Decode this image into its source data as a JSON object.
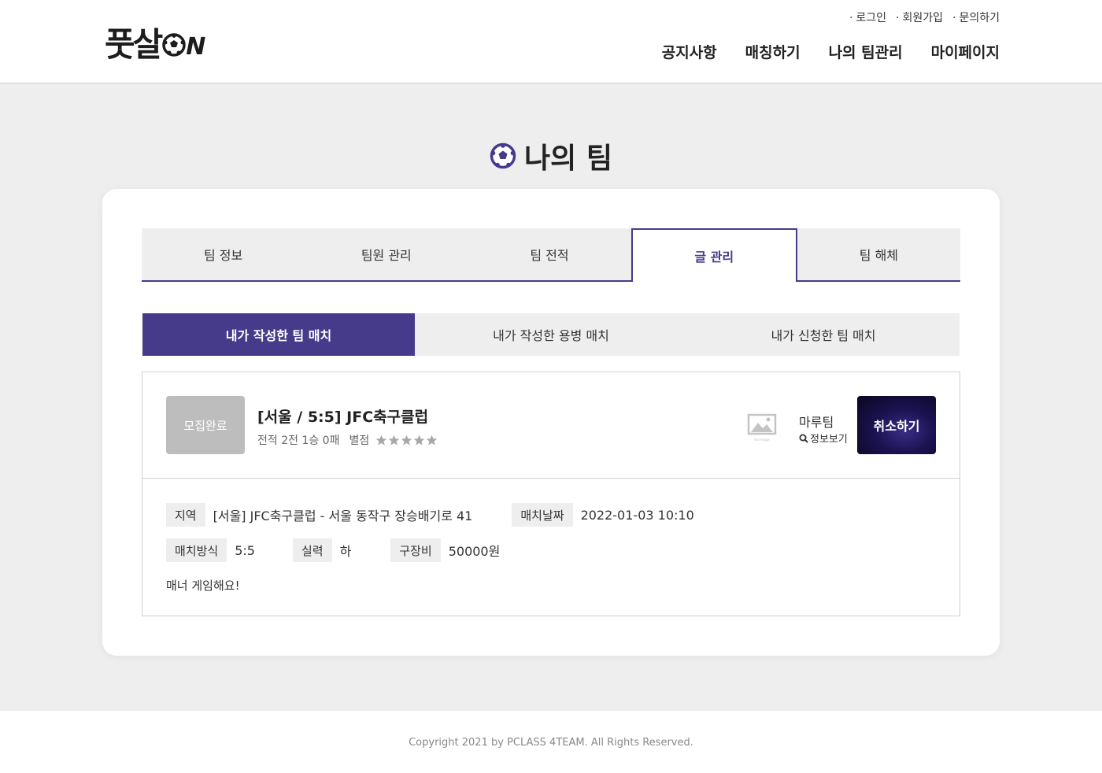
{
  "header": {
    "logo": {
      "main": "풋살",
      "suffix": "N"
    },
    "top_links": [
      "로그인",
      "회원가입",
      "문의하기"
    ],
    "nav": [
      "공지사항",
      "매칭하기",
      "나의 팀관리",
      "마이페이지"
    ]
  },
  "page": {
    "title": "나의 팀"
  },
  "tabs": [
    "팀 정보",
    "팀원 관리",
    "팀 전적",
    "글 관리",
    "팀 해체"
  ],
  "active_tab": "글 관리",
  "subtabs": [
    "내가 작성한 팀 매치",
    "내가 작성한 용병 매치",
    "내가 신청한 팀 매치"
  ],
  "active_subtab": "내가 작성한 팀 매치",
  "match": {
    "status": "모집완료",
    "title": "[서울 / 5:5] JFC축구클럽",
    "record": "전적 2전 1승 0패",
    "rating_label": "별점",
    "rating": 0,
    "rating_max": 5,
    "noimage_text": "No Image",
    "team_name": "마루팀",
    "info_link": "정보보기",
    "cancel_label": "취소하기",
    "region_label": "지역",
    "region_value": "[서울] JFC축구클럽 - 서울 동작구 장승배기로 41",
    "date_label": "매치날짜",
    "date_value": "2022-01-03 10:10",
    "type_label": "매치방식",
    "type_value": "5:5",
    "skill_label": "실력",
    "skill_value": "하",
    "fee_label": "구장비",
    "fee_value": "50000원",
    "memo": "매너 게임해요!"
  },
  "footer": {
    "copyright": "Copyright 2021 by PCLASS 4TEAM. All Rights Reserved."
  },
  "colors": {
    "accent": "#463b8a",
    "badge": "#bdbdbd",
    "background": "#eeeeee"
  },
  "icons": {
    "ball": "soccer-ball-icon",
    "search": "search-icon",
    "star": "star-icon",
    "no_image": "image-placeholder-icon"
  }
}
